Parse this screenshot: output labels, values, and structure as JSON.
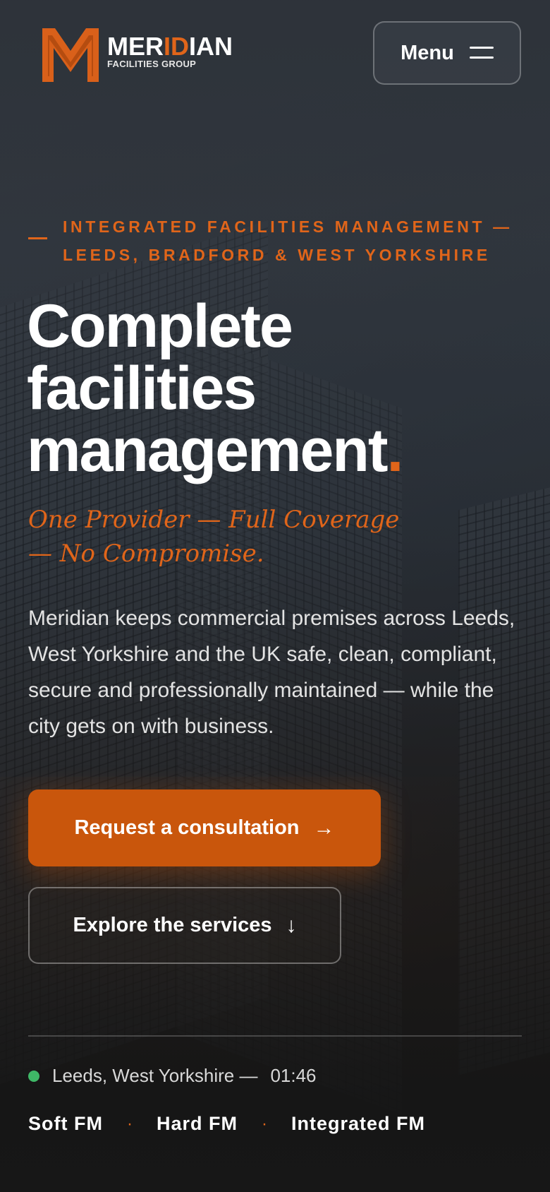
{
  "brand": {
    "name_part1": "MER",
    "name_accent": "ID",
    "name_part2": "IAN",
    "subtitle": "FACILITIES GROUP",
    "accent_color": "#e0651a"
  },
  "header": {
    "menu_label": "Menu",
    "menu_icon": "hamburger-icon"
  },
  "hero": {
    "eyebrow": "INTEGRATED FACILITIES MANAGEMENT — LEEDS, BRADFORD & WEST YORKSHIRE",
    "headline_line1": "Complete",
    "headline_line2": "facilities",
    "headline_line3": "management",
    "headline_dot": ".",
    "tagline": "One Provider — Full Coverage — No Compromise.",
    "lead": "Meridian keeps commercial premises across Leeds, West Yorkshire and the UK safe, clean, compliant, secure and professionally maintained — while the city gets on with business.",
    "primary_cta": "Request a consultation",
    "primary_cta_icon": "→",
    "secondary_cta": "Explore the services",
    "secondary_cta_icon": "↓"
  },
  "footer_bar": {
    "location": "Leeds, West Yorkshire —",
    "time": "01:46",
    "status_color": "#3fb867",
    "services": [
      "Soft FM",
      "Hard FM",
      "Integrated FM"
    ],
    "separator": "·"
  }
}
